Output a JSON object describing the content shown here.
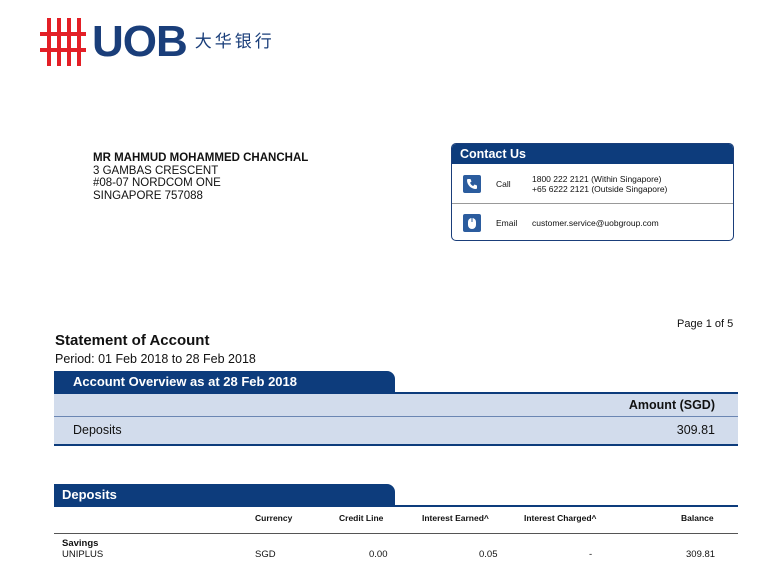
{
  "brand": {
    "name": "UOB",
    "chinese": "大华银行",
    "accent": "#e31f26",
    "primary": "#0d3c7c"
  },
  "address": {
    "name": "MR MAHMUD MOHAMMED CHANCHAL",
    "line1": "3 GAMBAS CRESCENT",
    "line2": "#08-07 NORDCOM ONE",
    "line3": "SINGAPORE 757088"
  },
  "contact": {
    "title": "Contact Us",
    "call_label": "Call",
    "call_line1": "1800 222 2121 (Within Singapore)",
    "call_line2": "+65 6222 2121 (Outside Singapore)",
    "email_label": "Email",
    "email": "customer.service@uobgroup.com",
    "call_icon": "phone-icon",
    "email_icon": "mouse-icon"
  },
  "page": {
    "label": "Page 1 of 5"
  },
  "statement": {
    "title": "Statement of Account",
    "period": "Period: 01 Feb 2018 to 28 Feb 2018"
  },
  "overview": {
    "title": "Account Overview as at 28 Feb 2018",
    "amount_header": "Amount (SGD)",
    "row_label": "Deposits",
    "row_value": "309.81"
  },
  "deposits": {
    "title": "Deposits",
    "headers": {
      "currency": "Currency",
      "credit_line": "Credit Line",
      "interest_earned": "Interest Earned^",
      "interest_charged": "Interest Charged^",
      "balance": "Balance"
    },
    "rows": [
      {
        "type": "Savings",
        "product": "UNIPLUS",
        "currency": "SGD",
        "credit_line": "0.00",
        "interest_earned": "0.05",
        "interest_charged": "-",
        "balance": "309.81"
      }
    ]
  }
}
